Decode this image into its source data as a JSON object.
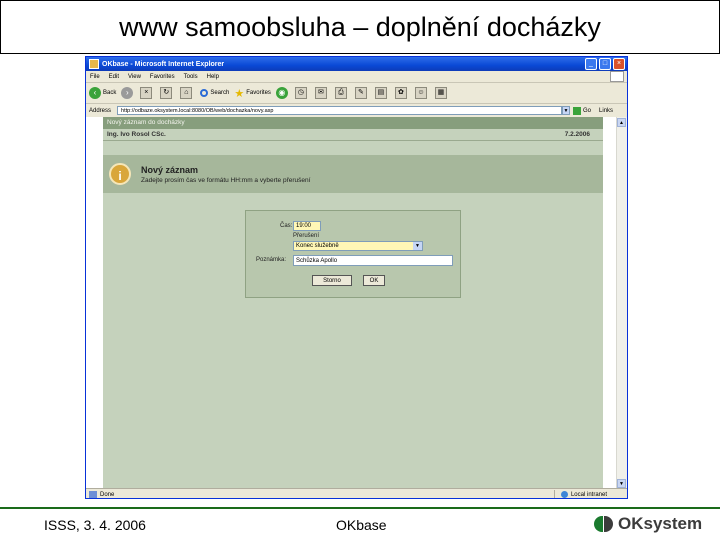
{
  "slide": {
    "title": "www samoobsluha – doplnění docházky",
    "footer_left": "ISSS, 3. 4. 2006",
    "footer_center": "OKbase",
    "logo_text": "OKsystem"
  },
  "browser": {
    "title": "OKbase - Microsoft Internet Explorer",
    "menu": [
      "File",
      "Edit",
      "View",
      "Favorites",
      "Tools",
      "Help"
    ],
    "toolbar": {
      "back": "Back",
      "search": "Search",
      "favorites": "Favorites"
    },
    "address_label": "Address",
    "address_url": "http://odbaze.oksystem.local:8080/OB/web/dochazka/novy.asp",
    "go_label": "Go",
    "links_label": "Links",
    "status_left": "Done",
    "status_zone": "Local intranet"
  },
  "page": {
    "header": "Nový záznam do docházky",
    "user": "Ing. Ivo Rosol CSc.",
    "date": "7.2.2006",
    "banner_icon": "info-icon",
    "banner_title": "Nový záznam",
    "banner_text": "Zadejte prosím čas ve formátu HH:mm a vyberte přerušení"
  },
  "form": {
    "time_label": "Čas:",
    "time_value": "19:00",
    "interruption_label": "Přerušení",
    "interruption_value": "Konec služebně",
    "note_label": "Poznámka:",
    "note_value": "Schůzka Apollo",
    "cancel_label": "Storno",
    "ok_label": "OK"
  },
  "colors": {
    "page_bg": "#c5d2bc",
    "header_bar": "#879e7d",
    "banner": "#a6b79b",
    "logo_green": "#1a7a2e",
    "footer_line": "#1a6b1a"
  }
}
